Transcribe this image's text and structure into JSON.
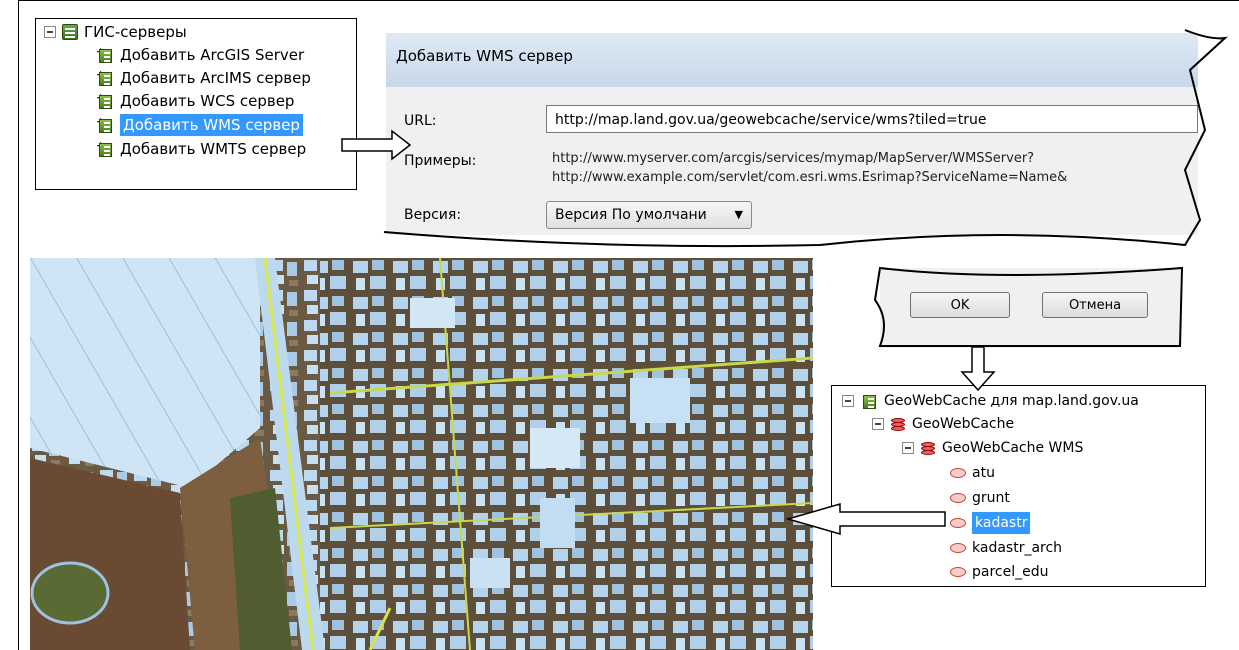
{
  "tree_top": {
    "root": "ГИС-серверы",
    "items": [
      "Добавить ArcGIS Server",
      "Добавить ArcIMS сервер",
      "Добавить WCS сервер",
      "Добавить WMS сервер",
      "Добавить WMTS сервер"
    ],
    "selected_index": 3
  },
  "dialog": {
    "title": "Добавить WMS сервер",
    "url_label": "URL:",
    "url_value": "http://map.land.gov.ua/geowebcache/service/wms?tiled=true",
    "examples_label": "Примеры:",
    "examples": [
      "http://www.myserver.com/arcgis/services/mymap/MapServer/WMSServer?",
      "http://www.example.com/servlet/com.esri.wms.Esrimap?ServiceName=Name&"
    ],
    "version_label": "Версия:",
    "version_value": "Версия По умолчани"
  },
  "buttons": {
    "ok": "OK",
    "cancel": "Отмена"
  },
  "tree_bottom": {
    "root": "GeoWebCache для map.land.gov.ua",
    "child": "GeoWebCache",
    "service": "GeoWebCache WMS",
    "layers": [
      "atu",
      "grunt",
      "kadastr",
      "kadastr_arch",
      "parcel_edu"
    ],
    "selected_layer_index": 2
  }
}
